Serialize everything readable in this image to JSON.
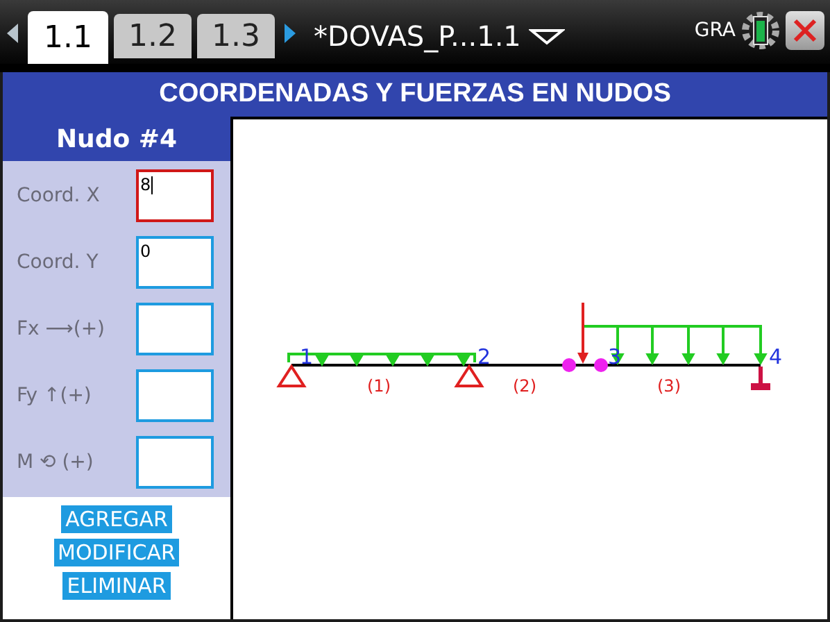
{
  "tabs": [
    {
      "label": "1.1",
      "selected": true
    },
    {
      "label": "1.2",
      "selected": false
    },
    {
      "label": "1.3",
      "selected": false
    }
  ],
  "document_title": "*DOVAS_P...1.1",
  "mode": "GRA",
  "title": "COORDENADAS Y FUERZAS EN NUDOS",
  "node_header": "Nudo #4",
  "fields": [
    {
      "label": "Coord. X",
      "value": "8",
      "focused": true
    },
    {
      "label": "Coord. Y",
      "value": "0",
      "focused": false
    },
    {
      "label": "Fx ⟶(+)",
      "focused": false
    },
    {
      "label": "Fy ↑(+)",
      "focused": false
    },
    {
      "label": "M ⟲ (+)",
      "focused": false
    }
  ],
  "buttons": [
    "AGREGAR",
    "MODIFICAR",
    "ELIMINAR"
  ],
  "diagram": {
    "nodes": [
      {
        "label": "1",
        "kind": "pin"
      },
      {
        "label": "2",
        "kind": "pin"
      },
      {
        "label": "3",
        "kind": "free"
      },
      {
        "label": "4",
        "kind": "fixed"
      }
    ],
    "members": [
      "(1)",
      "(2)",
      "(3)"
    ]
  }
}
